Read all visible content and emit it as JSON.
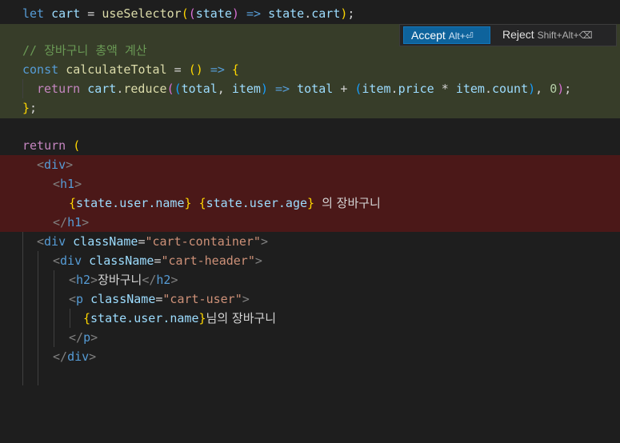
{
  "code": {
    "l1": {
      "let": "let",
      "cart": "cart",
      "eq": "=",
      "fn": "useSelector",
      "o1": "(",
      "o2": "(",
      "state": "state",
      "c2": ")",
      "arrow": "=>",
      "state2": "state",
      "dot": ".",
      "cart2": "cart",
      "c1": ")",
      "semi": ";"
    },
    "l3": {
      "comment": "// 장바구니 총액 계산"
    },
    "l4": {
      "const": "const",
      "name": "calculateTotal",
      "eq": "=",
      "o1": "(",
      "c1": ")",
      "arrow": "=>",
      "ob": "{"
    },
    "l5": {
      "ret": "return",
      "cart": "cart",
      "dot1": ".",
      "reduce": "reduce",
      "o1": "(",
      "o2": "(",
      "total": "total",
      "comma1": ",",
      "item": "item",
      "c2": ")",
      "arrow": "=>",
      "total2": "total",
      "plus": "+",
      "o3": "(",
      "item2": "item",
      "dot2": ".",
      "price": "price",
      "mul": "*",
      "item3": "item",
      "dot3": ".",
      "count": "count",
      "c3": ")",
      "comma2": ",",
      "zero": "0",
      "c1": ")",
      "semi": ";"
    },
    "l6": {
      "cb": "}",
      "semi": ";"
    },
    "l8": {
      "ret": "return",
      "o": "("
    },
    "l9": {
      "lt": "<",
      "tag": "div",
      "gt": ">"
    },
    "l10": {
      "lt": "<",
      "tag": "h1",
      "gt": ">"
    },
    "l11": {
      "o1": "{",
      "e1": "state.user.name",
      "c1": "}",
      "o2": "{",
      "e2": "state.user.age",
      "c2": "}",
      "text": "의 장바구니"
    },
    "l12": {
      "lt": "</",
      "tag": "h1",
      "gt": ">"
    },
    "l13": {
      "lt": "<",
      "tag": "div",
      "attr": "className",
      "eq": "=",
      "val": "\"cart-container\"",
      "gt": ">"
    },
    "l14": {
      "lt": "<",
      "tag": "div",
      "attr": "className",
      "eq": "=",
      "val": "\"cart-header\"",
      "gt": ">"
    },
    "l15": {
      "lt": "<",
      "tag": "h2",
      "gt": ">",
      "text": "장바구니",
      "lt2": "</",
      "tag2": "h2",
      "gt2": ">"
    },
    "l16": {
      "lt": "<",
      "tag": "p",
      "attr": "className",
      "eq": "=",
      "val": "\"cart-user\"",
      "gt": ">"
    },
    "l17": {
      "o": "{",
      "e": "state.user.name",
      "c": "}",
      "text": "님의 장바구니"
    },
    "l18": {
      "lt": "</",
      "tag": "p",
      "gt": ">"
    },
    "l19": {
      "lt": "</",
      "tag": "div",
      "gt": ">"
    }
  },
  "inline_chat": {
    "accept_label": "Accept",
    "accept_shortcut": "Alt+⏎",
    "reject_label": "Reject",
    "reject_shortcut": "Shift+Alt+⌫"
  },
  "colors": {
    "editor_bg": "#1e1e1e",
    "added_line_bg": "#373d29",
    "removed_line_bg": "#4b1818",
    "accept_button": "#0e639c"
  }
}
